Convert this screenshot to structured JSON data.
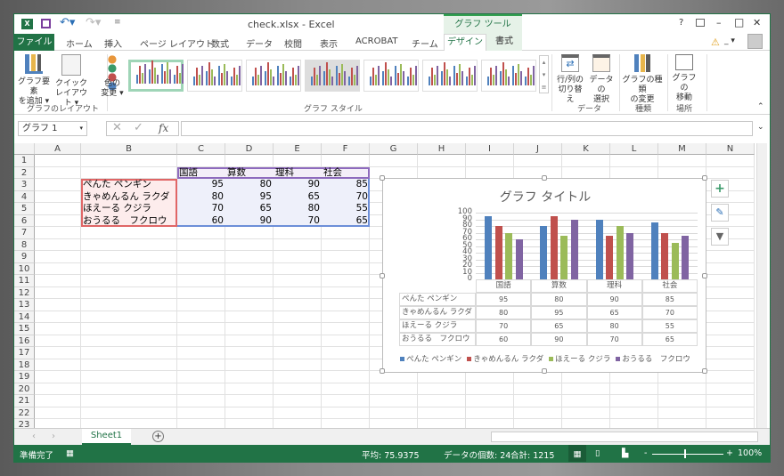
{
  "window": {
    "title": "check.xlsx - Excel",
    "context_tab_group": "グラフ ツール",
    "help": "?",
    "minimize": "–",
    "maximize": "□",
    "close": "✕"
  },
  "tabs": [
    {
      "label": "ファイル"
    },
    {
      "label": "ホーム"
    },
    {
      "label": "挿入"
    },
    {
      "label": "ページ レイアウト"
    },
    {
      "label": "数式"
    },
    {
      "label": "データ"
    },
    {
      "label": "校閲"
    },
    {
      "label": "表示"
    },
    {
      "label": "ACROBAT"
    },
    {
      "label": "チーム"
    },
    {
      "label": "デザイン"
    },
    {
      "label": "書式"
    }
  ],
  "ribbon": {
    "add_element": [
      "グラフ要素",
      "を追加 ▾"
    ],
    "quick_layout": [
      "クイック",
      "レイアウト ▾"
    ],
    "change_colors": [
      "色の",
      "変更 ▾"
    ],
    "switch_rowcol": [
      "行/列の",
      "切り替え"
    ],
    "select_data": [
      "データの",
      "選択"
    ],
    "change_type": [
      "グラフの種類",
      "の変更"
    ],
    "move_chart": [
      "グラフの",
      "移動"
    ],
    "groups": {
      "layout": "グラフのレイアウト",
      "styles": "グラフ スタイル",
      "data": "データ",
      "type": "種類",
      "location": "場所"
    }
  },
  "formula_bar": {
    "name_box": "グラフ 1",
    "fx": "fx",
    "value": ""
  },
  "columns": [
    "A",
    "B",
    "C",
    "D",
    "E",
    "F",
    "G",
    "H",
    "I",
    "J",
    "K",
    "L",
    "M",
    "N"
  ],
  "rows": [
    "1",
    "2",
    "3",
    "4",
    "5",
    "6",
    "7",
    "8",
    "9",
    "10",
    "11",
    "12",
    "13",
    "14",
    "15",
    "16",
    "17",
    "18",
    "19",
    "20",
    "21",
    "22",
    "23"
  ],
  "sheet": {
    "headers": [
      "国語",
      "算数",
      "理科",
      "社会"
    ],
    "names": [
      "ぺんた ペンギン",
      "きゃめんるん ラクダ",
      "ほえーる クジラ",
      "おうるる　フクロウ"
    ],
    "values": [
      [
        95,
        80,
        90,
        85
      ],
      [
        80,
        95,
        65,
        70
      ],
      [
        70,
        65,
        80,
        55
      ],
      [
        60,
        90,
        70,
        65
      ]
    ]
  },
  "chart_data": {
    "type": "bar",
    "title": "グラフ タイトル",
    "categories": [
      "国語",
      "算数",
      "理科",
      "社会"
    ],
    "series": [
      {
        "name": "ぺんた ペンギン",
        "values": [
          95,
          80,
          90,
          85
        ],
        "color": "#4f81bd"
      },
      {
        "name": "きゃめんるん ラクダ",
        "values": [
          80,
          95,
          65,
          70
        ],
        "color": "#c0504d"
      },
      {
        "name": "ほえーる クジラ",
        "values": [
          70,
          65,
          80,
          55
        ],
        "color": "#9bbb59"
      },
      {
        "name": "おうるる　フクロウ",
        "values": [
          60,
          90,
          70,
          65
        ],
        "color": "#8064a2"
      }
    ],
    "ylim": [
      0,
      100
    ],
    "yticks": [
      0,
      10,
      20,
      30,
      40,
      50,
      60,
      70,
      80,
      90,
      100
    ],
    "grid": true,
    "legend": "bottom",
    "data_table": true
  },
  "sheet_tabs": {
    "active": "Sheet1",
    "add": "+"
  },
  "status": {
    "ready": "準備完了",
    "average": "平均: 75.9375",
    "count": "データの個数: 24",
    "sum": "合計: 1215",
    "zoom": "100%"
  },
  "colors": {
    "accent": "#217346"
  }
}
